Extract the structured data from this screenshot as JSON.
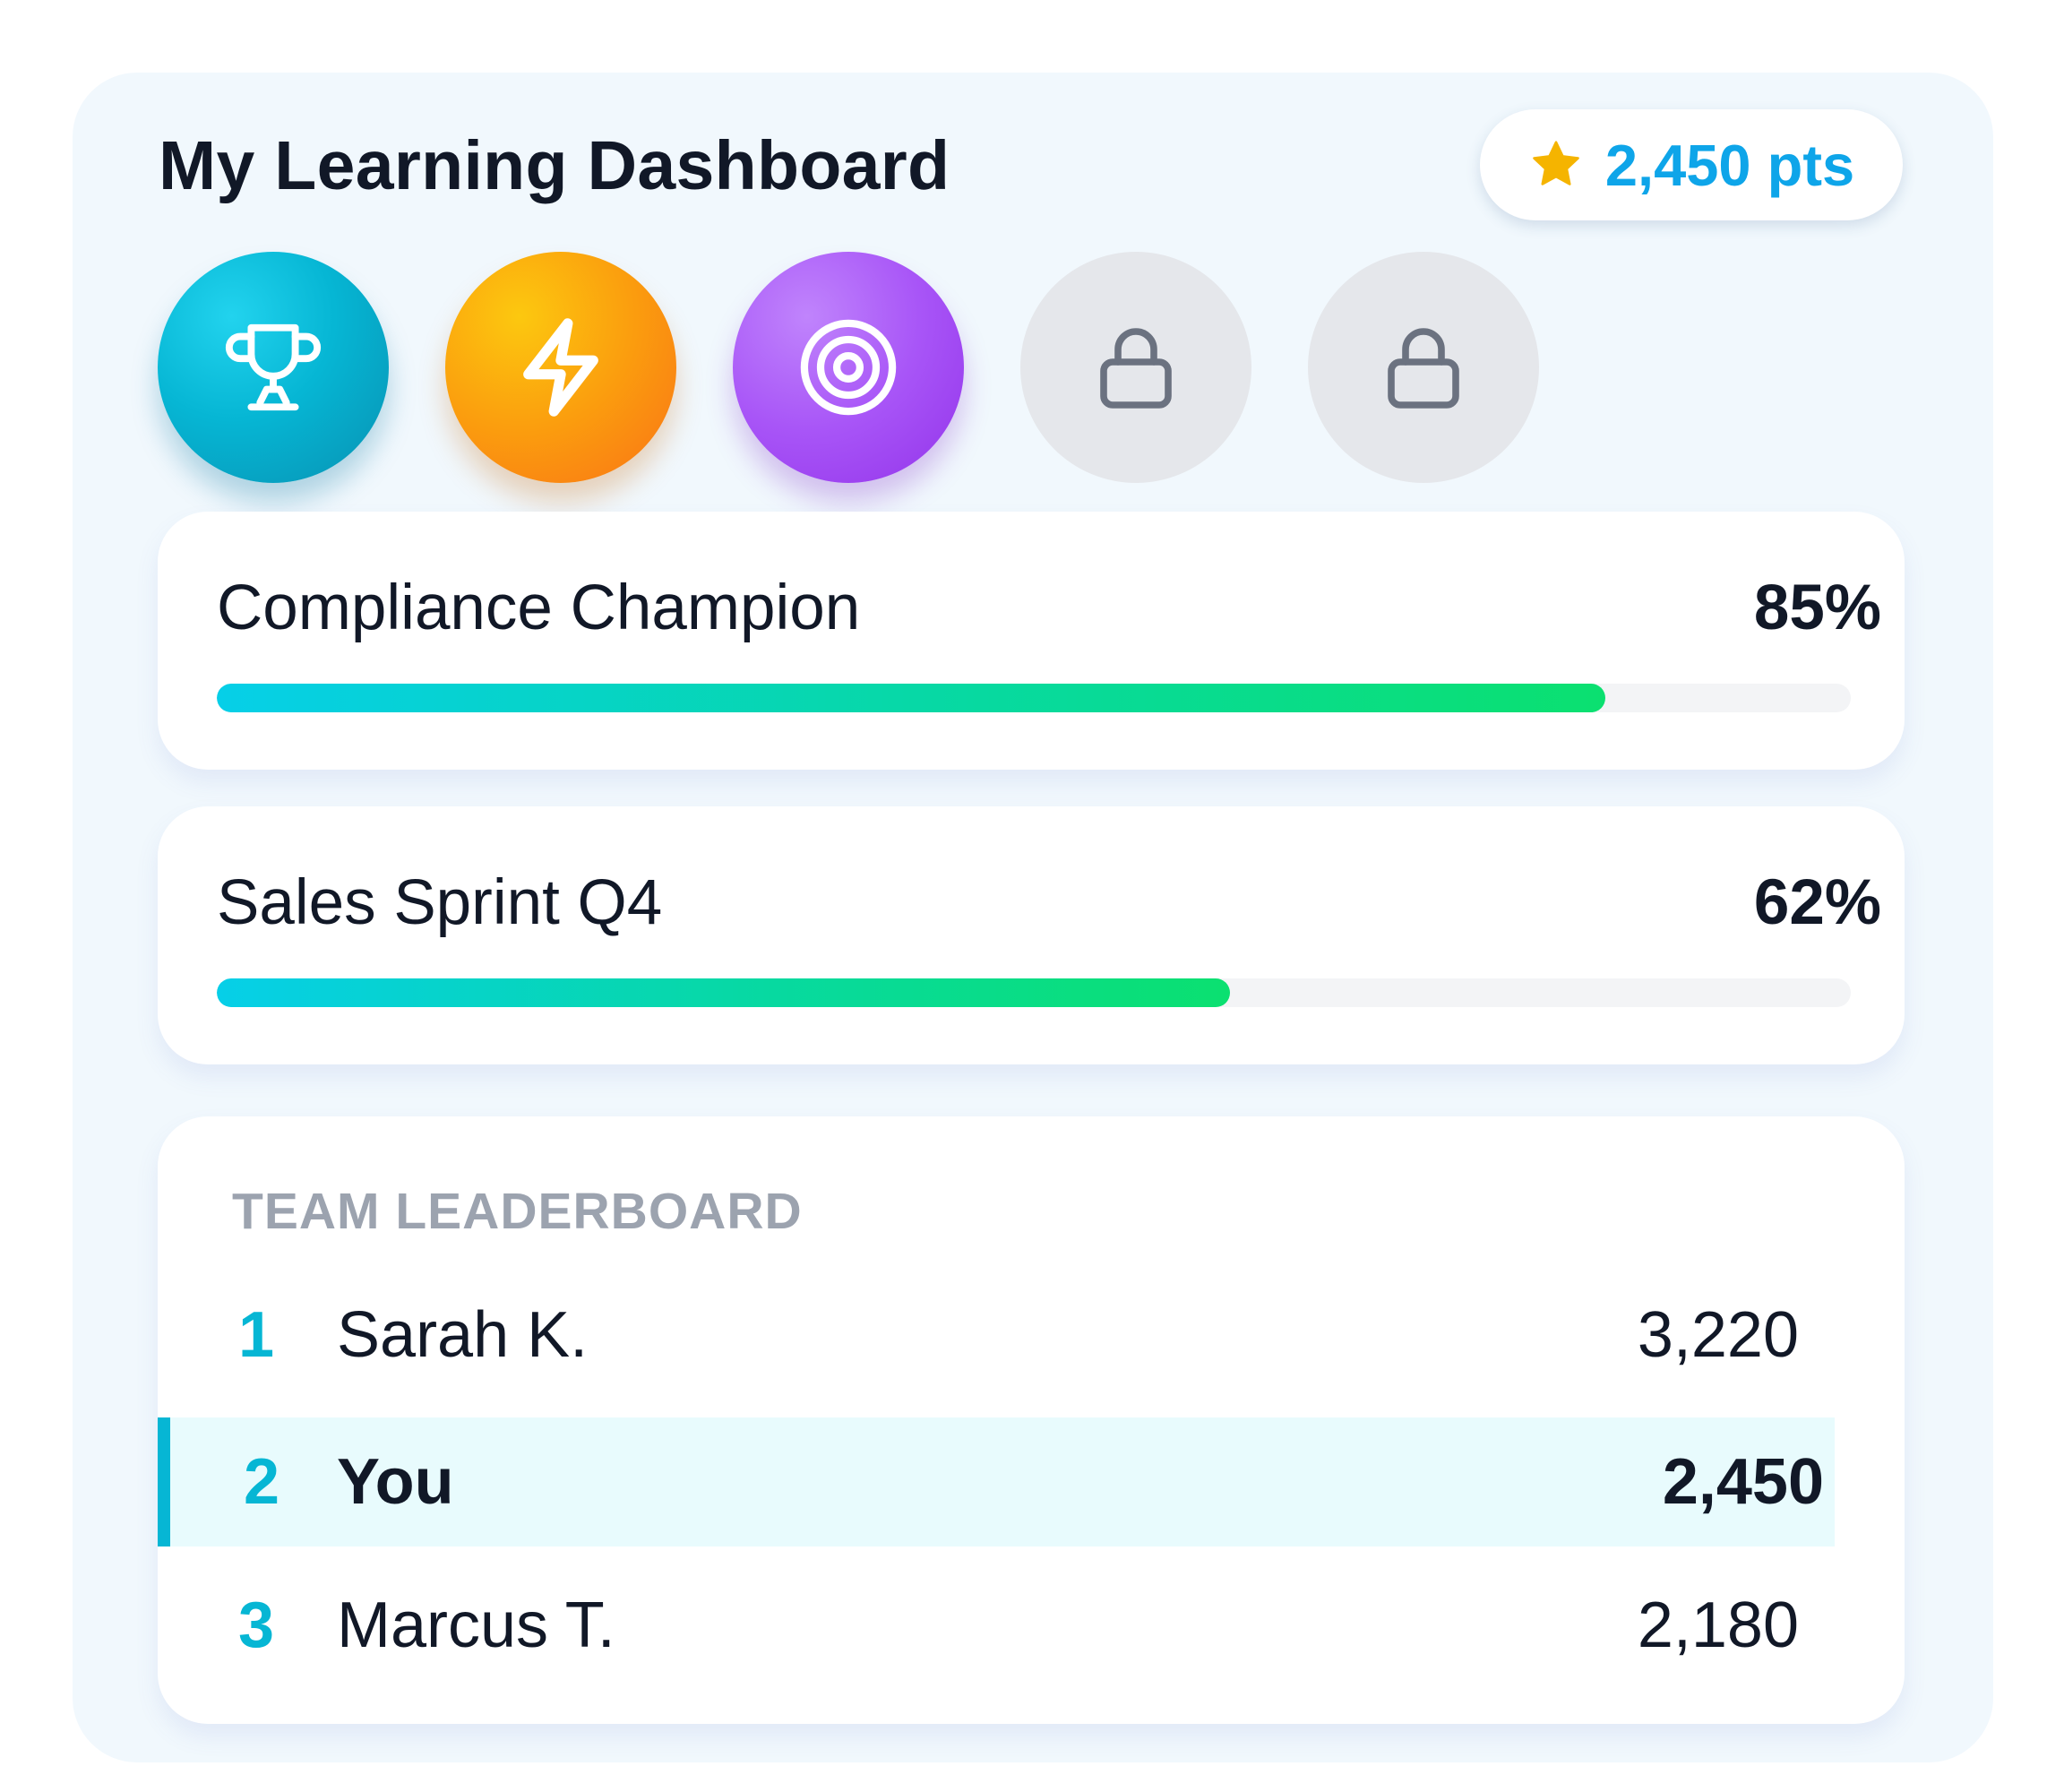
{
  "header": {
    "title": "My Learning Dashboard",
    "points": "2,450 pts",
    "points_icon": "star-icon"
  },
  "colors": {
    "accent": "#0ea5e9",
    "star": "#f5b400",
    "trophy_badge": "#06b6d4",
    "bolt_badge": "#f97316",
    "target_badge": "#a855f7",
    "locked_badge": "#e5e7eb",
    "progress_start": "#06cfe8",
    "progress_end": "#0be070",
    "highlight_row": "#e8fbfd"
  },
  "badges": [
    {
      "icon": "trophy-icon",
      "state": "earned"
    },
    {
      "icon": "lightning-icon",
      "state": "earned"
    },
    {
      "icon": "target-icon",
      "state": "earned"
    },
    {
      "icon": "lock-icon",
      "state": "locked"
    },
    {
      "icon": "lock-icon",
      "state": "locked"
    }
  ],
  "progress": [
    {
      "name": "Compliance Champion",
      "percent_label": "85%",
      "value": 0.85
    },
    {
      "name": "Sales Sprint Q4",
      "percent_label": "62%",
      "value": 0.62
    }
  ],
  "leaderboard": {
    "heading": "TEAM LEADERBOARD",
    "rows": [
      {
        "rank": "1",
        "name": "Sarah K.",
        "score": "3,220",
        "current_user": false
      },
      {
        "rank": "2",
        "name": "You",
        "score": "2,450",
        "current_user": true
      },
      {
        "rank": "3",
        "name": "Marcus T.",
        "score": "2,180",
        "current_user": false
      }
    ]
  }
}
